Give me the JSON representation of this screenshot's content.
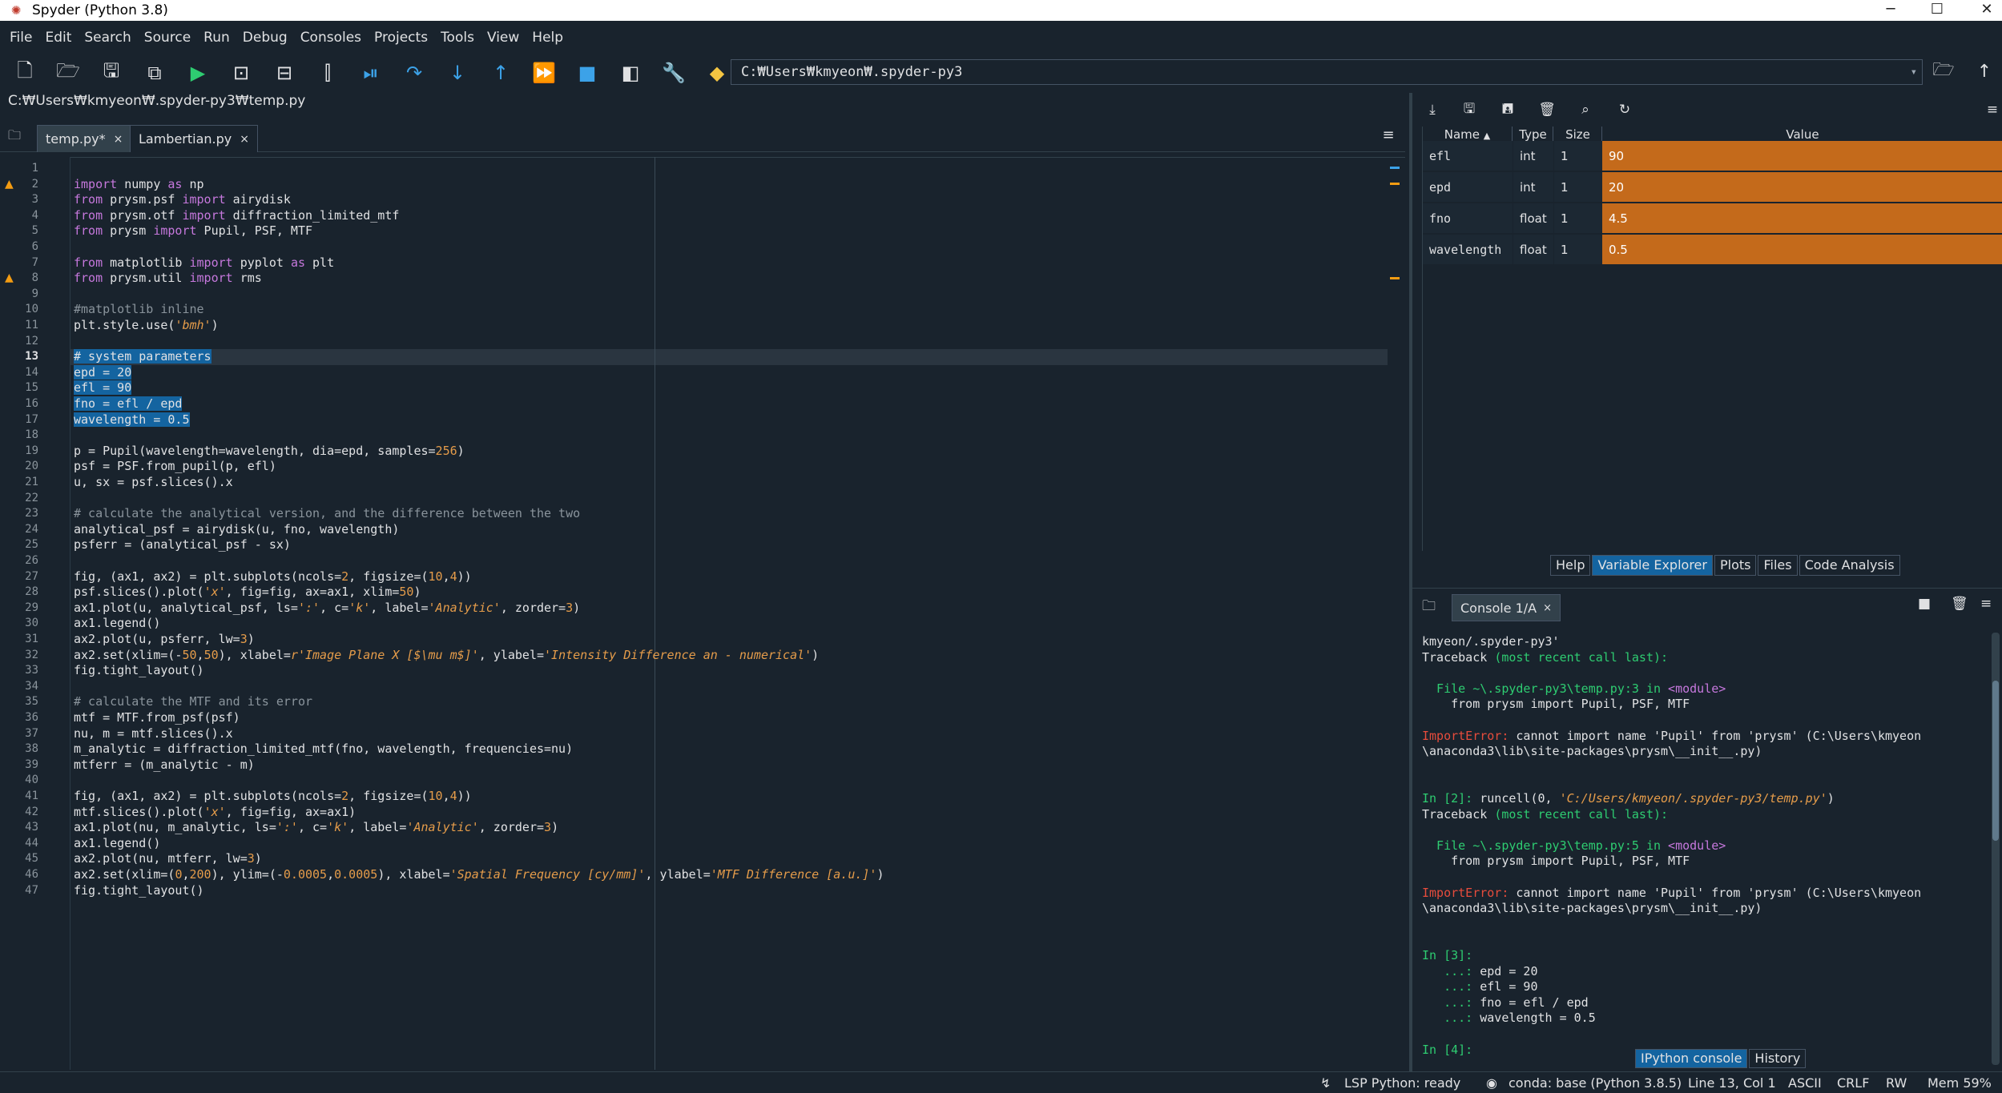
{
  "window": {
    "title": "Spyder (Python 3.8)",
    "controls": [
      "─",
      "☐",
      "✕"
    ]
  },
  "menu": [
    "File",
    "Edit",
    "Search",
    "Source",
    "Run",
    "Debug",
    "Consoles",
    "Projects",
    "Tools",
    "View",
    "Help"
  ],
  "toolbar": {
    "path": "C:₩Users₩kmyeon₩.spyder-py3"
  },
  "editor": {
    "file_path": "C:₩Users₩kmyeon₩.spyder-py3₩temp.py",
    "tabs": [
      {
        "label": "temp.py*",
        "close": "×"
      },
      {
        "label": "Lambertian.py",
        "close": "×"
      }
    ],
    "current_line": 13,
    "warning_lines": [
      2,
      8
    ],
    "lines": [
      "",
      "import numpy as np",
      "from prysm.psf import airydisk",
      "from prysm.otf import diffraction_limited_mtf",
      "from prysm import Pupil, PSF, MTF",
      "",
      "from matplotlib import pyplot as plt",
      "from prysm.util import rms",
      "",
      "#matplotlib inline",
      "plt.style.use('bmh')",
      "",
      "# system parameters",
      "epd = 20",
      "efl = 90",
      "fno = efl / epd",
      "wavelength = 0.5",
      "",
      "p = Pupil(wavelength=wavelength, dia=epd, samples=256)",
      "psf = PSF.from_pupil(p, efl)",
      "u, sx = psf.slices().x",
      "",
      "# calculate the analytical version, and the difference between the two",
      "analytical_psf = airydisk(u, fno, wavelength)",
      "psferr = (analytical_psf - sx)",
      "",
      "fig, (ax1, ax2) = plt.subplots(ncols=2, figsize=(10,4))",
      "psf.slices().plot('x', fig=fig, ax=ax1, xlim=50)",
      "ax1.plot(u, analytical_psf, ls=':', c='k', label='Analytic', zorder=3)",
      "ax1.legend()",
      "ax2.plot(u, psferr, lw=3)",
      "ax2.set(xlim=(-50,50), xlabel=r'Image Plane X [$\\mu m$]', ylabel='Intensity Difference an - numerical')",
      "fig.tight_layout()",
      "",
      "# calculate the MTF and its error",
      "mtf = MTF.from_psf(psf)",
      "nu, m = mtf.slices().x",
      "m_analytic = diffraction_limited_mtf(fno, wavelength, frequencies=nu)",
      "mtferr = (m_analytic - m)",
      "",
      "fig, (ax1, ax2) = plt.subplots(ncols=2, figsize=(10,4))",
      "mtf.slices().plot('x', fig=fig, ax=ax1)",
      "ax1.plot(nu, m_analytic, ls=':', c='k', label='Analytic', zorder=3)",
      "ax1.legend()",
      "ax2.plot(nu, mtferr, lw=3)",
      "ax2.set(xlim=(0,200), ylim=(-0.0005,0.0005), xlabel='Spatial Frequency [cy/mm]', ylabel='MTF Difference [a.u.]')",
      "fig.tight_layout()"
    ]
  },
  "variable_explorer": {
    "headers": [
      "Name",
      "Type",
      "Size",
      "Value"
    ],
    "rows": [
      {
        "name": "efl",
        "type": "int",
        "size": "1",
        "value": "90"
      },
      {
        "name": "epd",
        "type": "int",
        "size": "1",
        "value": "20"
      },
      {
        "name": "fno",
        "type": "float",
        "size": "1",
        "value": "4.5"
      },
      {
        "name": "wavelength",
        "type": "float",
        "size": "1",
        "value": "0.5"
      }
    ],
    "value_color": "#c46a1b"
  },
  "pane_tabs": [
    "Help",
    "Variable Explorer",
    "Plots",
    "Files",
    "Code Analysis"
  ],
  "console": {
    "tab_label": "Console 1/A",
    "tab_close": "×",
    "lines": [
      "kmyeon/.spyder-py3'",
      "Traceback (most recent call last):",
      "",
      "  File ~\\.spyder-py3\\temp.py:3 in <module>",
      "    from prysm import Pupil, PSF, MTF",
      "",
      "ImportError: cannot import name 'Pupil' from 'prysm' (C:\\Users\\kmyeon",
      "\\anaconda3\\lib\\site-packages\\prysm\\__init__.py)",
      "",
      "",
      "In [2]: runcell(0, 'C:/Users/kmyeon/.spyder-py3/temp.py')",
      "Traceback (most recent call last):",
      "",
      "  File ~\\.spyder-py3\\temp.py:5 in <module>",
      "    from prysm import Pupil, PSF, MTF",
      "",
      "ImportError: cannot import name 'Pupil' from 'prysm' (C:\\Users\\kmyeon",
      "\\anaconda3\\lib\\site-packages\\prysm\\__init__.py)",
      "",
      "",
      "In [3]:",
      "   ...: epd = 20",
      "   ...: efl = 90",
      "   ...: fno = efl / epd",
      "   ...: wavelength = 0.5",
      "",
      "In [4]:"
    ]
  },
  "console_tabs": [
    "IPython console",
    "History"
  ],
  "status": {
    "lsp": "LSP Python: ready",
    "conda": "conda: base (Python 3.8.5)",
    "position": "Line 13, Col 1",
    "encoding": "ASCII",
    "eol": "CRLF",
    "rw": "RW",
    "mem": "Mem 59%"
  }
}
